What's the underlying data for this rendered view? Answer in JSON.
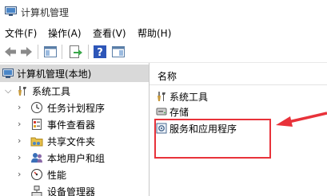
{
  "window": {
    "title": "计算机管理",
    "app_icon": "computer-management-icon"
  },
  "menu": [
    {
      "label": "文件(F)"
    },
    {
      "label": "操作(A)"
    },
    {
      "label": "查看(V)"
    },
    {
      "label": "帮助(H)"
    }
  ],
  "toolbar": {
    "buttons": [
      "back-icon",
      "forward-icon",
      "console-tree-icon",
      "export-list-icon",
      "help-icon",
      "action-pane-icon"
    ]
  },
  "tree": {
    "root": {
      "label": "计算机管理(本地)",
      "icon": "computer-management-icon"
    },
    "system_tools": {
      "label": "系统工具",
      "icon": "tools-icon"
    },
    "items": [
      {
        "label": "任务计划程序",
        "icon": "clock-icon"
      },
      {
        "label": "事件查看器",
        "icon": "event-viewer-icon"
      },
      {
        "label": "共享文件夹",
        "icon": "shared-folder-icon"
      },
      {
        "label": "本地用户和组",
        "icon": "users-icon"
      },
      {
        "label": "性能",
        "icon": "performance-icon"
      },
      {
        "label": "设备管理器",
        "icon": "device-manager-icon"
      }
    ]
  },
  "list": {
    "column_header": "名称",
    "items": [
      {
        "label": "系统工具",
        "icon": "tools-icon"
      },
      {
        "label": "存储",
        "icon": "storage-icon"
      },
      {
        "label": "服务和应用程序",
        "icon": "services-icon"
      }
    ]
  },
  "annotation": {
    "color": "#e8323a"
  }
}
